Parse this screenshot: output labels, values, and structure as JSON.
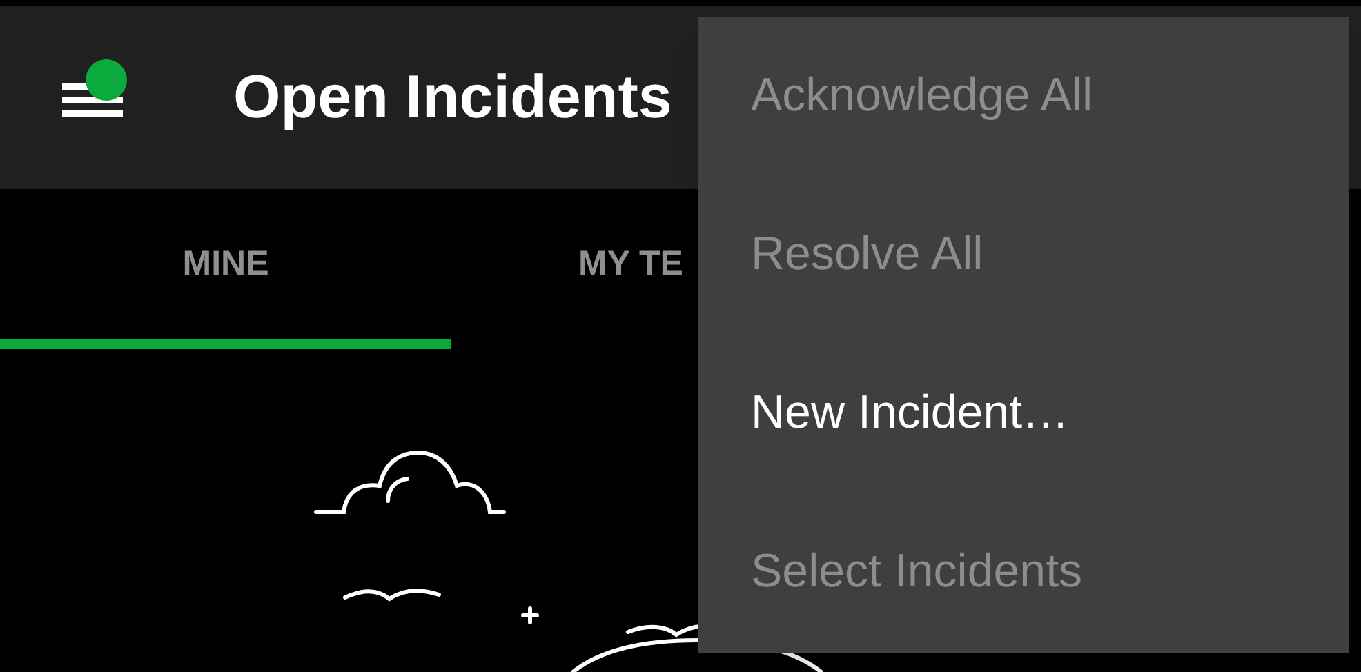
{
  "app_bar": {
    "title": "Open Incidents",
    "menu_badge": {
      "color": "#0aab3c"
    }
  },
  "tabs": [
    {
      "label": "MINE",
      "selected": true
    },
    {
      "label": "MY TE",
      "selected": false
    }
  ],
  "overflow_menu": {
    "items": [
      {
        "label": "Acknowledge All",
        "disabled": true
      },
      {
        "label": "Resolve All",
        "disabled": true
      },
      {
        "label": "New Incident…",
        "disabled": false
      },
      {
        "label": "Select Incidents",
        "disabled": true
      }
    ]
  }
}
